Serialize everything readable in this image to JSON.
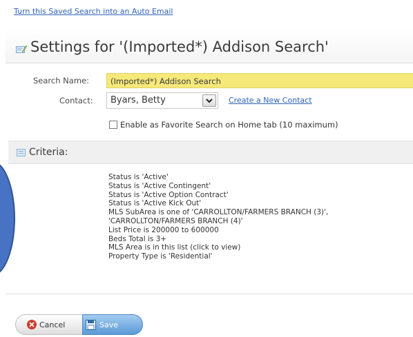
{
  "top_link": "Turn this Saved Search into an Auto Email",
  "settings": {
    "title": "Settings for '(Imported*) Addison Search'"
  },
  "form": {
    "search_name_label": "Search Name:",
    "search_name_value": "(Imported*) Addison Search",
    "contact_label": "Contact:",
    "contact_value": "Byars, Betty",
    "create_contact_link": "Create a New Contact",
    "favorite_label": "Enable as Favorite Search on Home tab (10 maximum)",
    "favorite_checked": false
  },
  "criteria": {
    "title": "Criteria:",
    "items": [
      "Status is 'Active'",
      "Status is 'Active Contingent'",
      "Status is 'Active Option Contract'",
      "Status is 'Active Kick Out'",
      "MLS SubArea is one of 'CARROLLTON/FARMERS BRANCH (3)',",
      "'CARROLLTON/FARMERS BRANCH (4)'",
      "List Price is 200000 to 600000",
      "Beds Total is 3+",
      "MLS Area is in this list (click to view)",
      "Property Type is 'Residential'"
    ]
  },
  "buttons": {
    "cancel_label": "Cancel",
    "save_label": "Save"
  },
  "icons": {
    "settings": "settings-edit-icon",
    "dropdown": "chevron-down-icon",
    "criteria": "list-icon",
    "cancel": "cancel-icon",
    "save": "save-icon"
  },
  "colors": {
    "link": "#2f63b8",
    "highlight": "#f6e97a",
    "section_bg": "#f0f0f0",
    "save_button": "#5c9ad6",
    "cancel_icon": "#cf3a2c",
    "overlay_oval": "#4873c4"
  }
}
